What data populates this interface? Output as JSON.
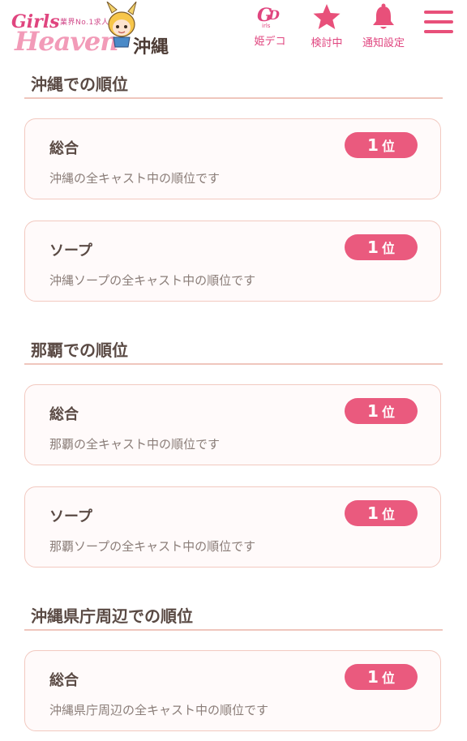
{
  "header": {
    "logo_small": "業界No.1求人サイト",
    "logo_girls": "Girls",
    "logo_heaven": "Heaven",
    "area": "沖縄",
    "buttons": [
      {
        "label": "姫デコ",
        "icon": "hime-deco-icon"
      },
      {
        "label": "検討中",
        "icon": "star-icon"
      },
      {
        "label": "通知設定",
        "icon": "bell-icon"
      },
      {
        "label": "",
        "icon": "menu-icon"
      }
    ]
  },
  "colors": {
    "accent": "#ea5a7e",
    "rule": "#efc6bd",
    "card_border": "#f2c9c0"
  },
  "sections": [
    {
      "title": "沖縄での順位",
      "cards": [
        {
          "title": "総合",
          "rank": "1",
          "unit": "位",
          "desc": "沖縄の全キャスト中の順位です"
        },
        {
          "title": "ソープ",
          "rank": "1",
          "unit": "位",
          "desc": "沖縄ソープの全キャスト中の順位です"
        }
      ]
    },
    {
      "title": "那覇での順位",
      "cards": [
        {
          "title": "総合",
          "rank": "1",
          "unit": "位",
          "desc": "那覇の全キャスト中の順位です"
        },
        {
          "title": "ソープ",
          "rank": "1",
          "unit": "位",
          "desc": "那覇ソープの全キャスト中の順位です"
        }
      ]
    },
    {
      "title": "沖縄県庁周辺での順位",
      "cards": [
        {
          "title": "総合",
          "rank": "1",
          "unit": "位",
          "desc": "沖縄県庁周辺の全キャスト中の順位です"
        }
      ]
    }
  ]
}
